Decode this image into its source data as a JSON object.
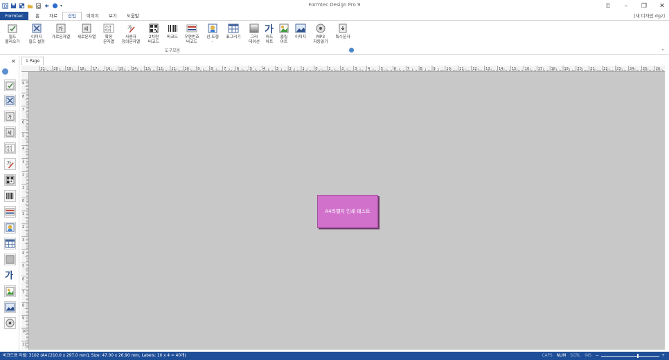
{
  "app": {
    "title": "Formtec Design Pro 9",
    "doc_name": "[새 디자인.dgz]",
    "window_buttons": [
      "⍐",
      "–",
      "❐",
      "✕"
    ]
  },
  "quick_access": [
    "app-icon",
    "save-icon",
    "save-all-icon",
    "open-icon",
    "print-preview-icon",
    "undo-icon",
    "help-icon"
  ],
  "file_tab": "Formtec",
  "tabs": [
    {
      "label": "홈",
      "active": false
    },
    {
      "label": "자료",
      "active": false
    },
    {
      "label": "삽입",
      "active": true
    },
    {
      "label": "이미지",
      "active": false
    },
    {
      "label": "보기",
      "active": false
    },
    {
      "label": "도움말",
      "active": false
    }
  ],
  "ribbon": {
    "buttons": [
      {
        "label": "필드\n불러오기",
        "icon": "field-load-icon"
      },
      {
        "label": "이미지\n필드 설정",
        "icon": "image-field-icon"
      },
      {
        "label": "가로문자열",
        "icon": "horizontal-text-icon"
      },
      {
        "label": "세로문자열",
        "icon": "vertical-text-icon"
      },
      {
        "label": "확장\n문자열",
        "icon": "extended-text-icon"
      },
      {
        "label": "사용자\n정의문자열",
        "icon": "custom-text-icon"
      },
      {
        "label": "2차원\n바코드",
        "icon": "qr-code-icon"
      },
      {
        "label": "바코드",
        "icon": "barcode-icon"
      },
      {
        "label": "우편번호\n바코드",
        "icon": "postal-barcode-icon"
      },
      {
        "label": "선.도형\n-",
        "icon": "shapes-icon"
      },
      {
        "label": "표그리기",
        "icon": "table-icon"
      },
      {
        "label": "그라\n데이션",
        "icon": "gradient-icon"
      },
      {
        "label": "워드\n아트",
        "icon": "word-art-icon"
      },
      {
        "label": "클립\n아트",
        "icon": "clip-art-icon"
      },
      {
        "label": "이미지",
        "icon": "image-icon"
      },
      {
        "label": "MP3\n자동읽기",
        "icon": "mp3-icon"
      },
      {
        "label": "특수문자",
        "icon": "special-char-icon"
      }
    ],
    "group_label": "도구모음"
  },
  "page_tab": "1 Page",
  "ruler": {
    "h_labels": [
      "21",
      "20",
      "19",
      "18",
      "17",
      "16",
      "15",
      "14",
      "13",
      "12",
      "11",
      "10",
      "9",
      "8",
      "7",
      "6",
      "5",
      "4",
      "3",
      "2",
      "1",
      "0",
      "1",
      "2",
      "3",
      "4",
      "5",
      "6",
      "7",
      "8",
      "9",
      "10",
      "11",
      "12",
      "13",
      "14",
      "15",
      "16",
      "17",
      "18",
      "19",
      "20",
      "21",
      "22",
      "23",
      "24",
      "25",
      "26"
    ],
    "v_labels": [
      "9",
      "8",
      "7",
      "6",
      "5",
      "4",
      "3",
      "2",
      "1",
      "0",
      "1",
      "2",
      "3",
      "4",
      "5",
      "6",
      "7",
      "8",
      "9",
      "10",
      "11"
    ]
  },
  "canvas": {
    "label_text": "A4라벨지 인쇄 테스트",
    "label_color": "#d171cc"
  },
  "status": {
    "text": "바코드용 라벨: 3102 (A4 [210.0 x 297.0 mm], Size: 47.00 x 26.90 mm,  Labels: 10 x 4 = 40개)",
    "indicators": [
      {
        "label": "CAPS",
        "on": false
      },
      {
        "label": "NUM",
        "on": true
      },
      {
        "label": "SCRL",
        "on": false
      },
      {
        "label": "INS",
        "on": false
      }
    ],
    "zoom_minus": "−",
    "zoom_plus": "+",
    "zoom_level": 0.62
  },
  "colors": {
    "accent": "#1f4e98",
    "canvas": "#c8c8c8"
  }
}
